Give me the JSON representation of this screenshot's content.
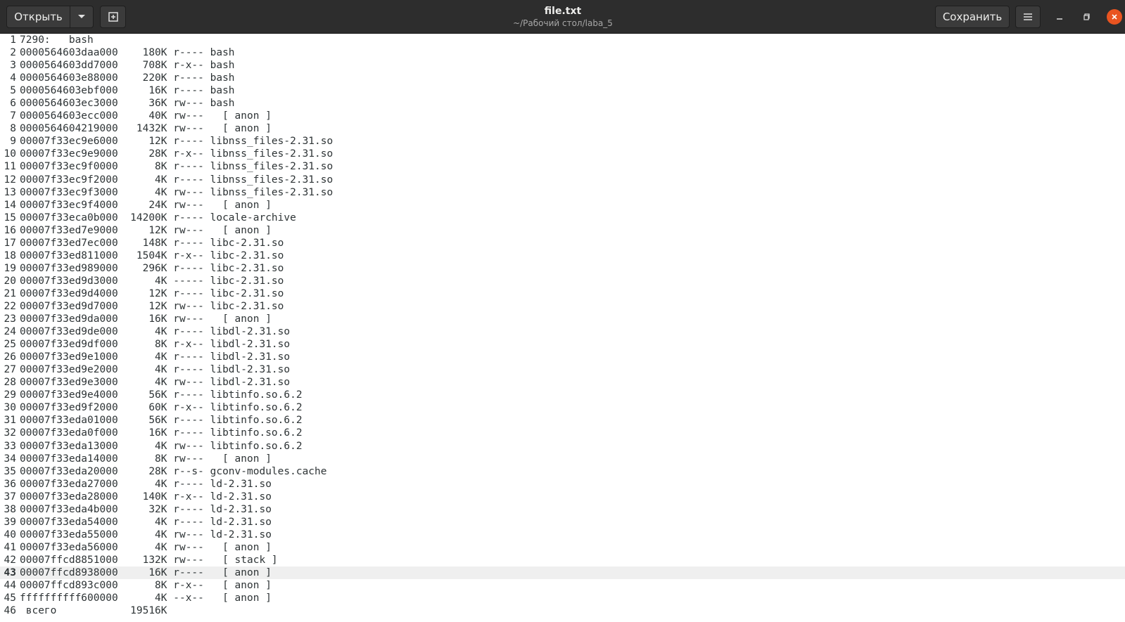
{
  "header": {
    "open_label": "Открыть",
    "title": "file.txt",
    "subtitle": "~/Рабочий стол/laba_5",
    "save_label": "Сохранить",
    "icons": {
      "open_dropdown": "chevron-down-icon",
      "new_document": "new-document-icon",
      "menu": "hamburger-menu-icon",
      "minimize": "minimize-icon",
      "maximize": "maximize-icon",
      "close": "close-icon"
    },
    "close_color": "#e95420"
  },
  "editor": {
    "current_line": 43,
    "lines": [
      "7290:   bash",
      "0000564603daa000    180K r---- bash",
      "0000564603dd7000    708K r-x-- bash",
      "0000564603e88000    220K r---- bash",
      "0000564603ebf000     16K r---- bash",
      "0000564603ec3000     36K rw--- bash",
      "0000564603ecc000     40K rw---   [ anon ]",
      "0000564604219000   1432K rw---   [ anon ]",
      "00007f33ec9e6000     12K r---- libnss_files-2.31.so",
      "00007f33ec9e9000     28K r-x-- libnss_files-2.31.so",
      "00007f33ec9f0000      8K r---- libnss_files-2.31.so",
      "00007f33ec9f2000      4K r---- libnss_files-2.31.so",
      "00007f33ec9f3000      4K rw--- libnss_files-2.31.so",
      "00007f33ec9f4000     24K rw---   [ anon ]",
      "00007f33eca0b000  14200K r---- locale-archive",
      "00007f33ed7e9000     12K rw---   [ anon ]",
      "00007f33ed7ec000    148K r---- libc-2.31.so",
      "00007f33ed811000   1504K r-x-- libc-2.31.so",
      "00007f33ed989000    296K r---- libc-2.31.so",
      "00007f33ed9d3000      4K ----- libc-2.31.so",
      "00007f33ed9d4000     12K r---- libc-2.31.so",
      "00007f33ed9d7000     12K rw--- libc-2.31.so",
      "00007f33ed9da000     16K rw---   [ anon ]",
      "00007f33ed9de000      4K r---- libdl-2.31.so",
      "00007f33ed9df000      8K r-x-- libdl-2.31.so",
      "00007f33ed9e1000      4K r---- libdl-2.31.so",
      "00007f33ed9e2000      4K r---- libdl-2.31.so",
      "00007f33ed9e3000      4K rw--- libdl-2.31.so",
      "00007f33ed9e4000     56K r---- libtinfo.so.6.2",
      "00007f33ed9f2000     60K r-x-- libtinfo.so.6.2",
      "00007f33eda01000     56K r---- libtinfo.so.6.2",
      "00007f33eda0f000     16K r---- libtinfo.so.6.2",
      "00007f33eda13000      4K rw--- libtinfo.so.6.2",
      "00007f33eda14000      8K rw---   [ anon ]",
      "00007f33eda20000     28K r--s- gconv-modules.cache",
      "00007f33eda27000      4K r---- ld-2.31.so",
      "00007f33eda28000    140K r-x-- ld-2.31.so",
      "00007f33eda4b000     32K r---- ld-2.31.so",
      "00007f33eda54000      4K r---- ld-2.31.so",
      "00007f33eda55000      4K rw--- ld-2.31.so",
      "00007f33eda56000      4K rw---   [ anon ]",
      "00007ffcd8851000    132K rw---   [ stack ]",
      "00007ffcd8938000     16K r----   [ anon ]",
      "00007ffcd893c000      8K r-x--   [ anon ]",
      "ffffffffff600000      4K --x--   [ anon ]",
      " всего            19516K"
    ]
  }
}
